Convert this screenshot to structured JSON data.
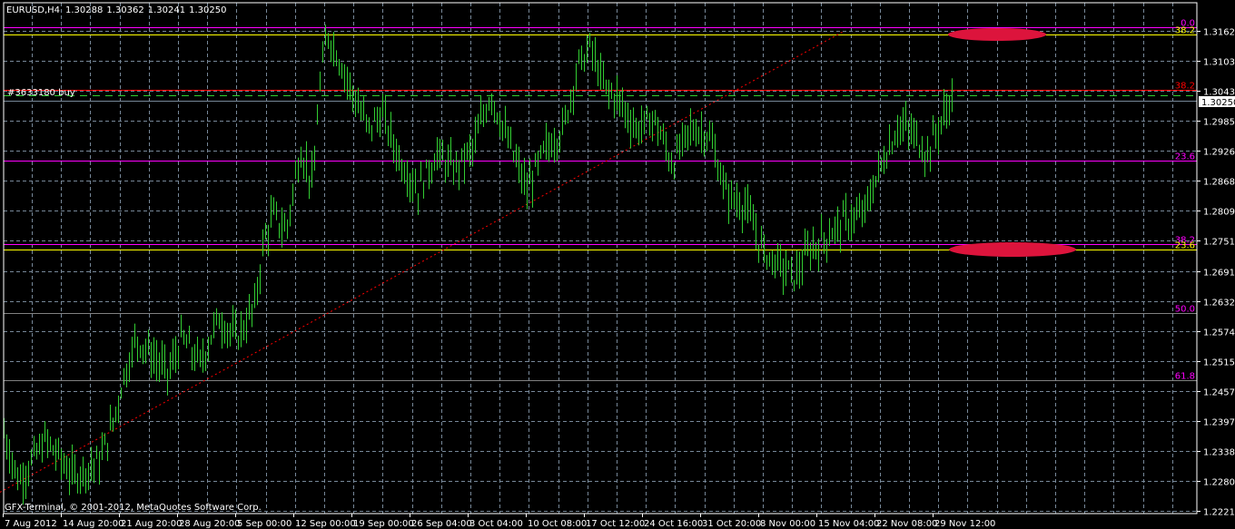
{
  "header": {
    "symbol_tf": "EURUSD,H4",
    "open": "1.30288",
    "high": "1.30362",
    "low": "1.30241",
    "close": "1.30250"
  },
  "order_label": "#3633180 buy",
  "copyright": "GFX-Terminal, © 2001-2012, MetaQuotes Software Corp.",
  "current_price": "1.30250",
  "colors": {
    "background": "#000000",
    "bars": "#32cd32",
    "grid": "#778899",
    "fib_magenta": "#ff00ff",
    "fib_yellow": "#ffff00",
    "fib_red": "#ff0000",
    "ellipse": "#dc143c",
    "trendline": "#ff0000",
    "order_line": "#32cd32"
  },
  "chart_data": {
    "type": "bar",
    "title": "EURUSD,H4",
    "ylim": [
      1.22215,
      1.3162
    ],
    "y_ticks": [
      "1.31620",
      "1.31035",
      "1.30435",
      "1.29850",
      "1.29265",
      "1.28680",
      "1.28095",
      "1.27510",
      "1.26910",
      "1.26325",
      "1.25740",
      "1.25155",
      "1.24570",
      "1.23970",
      "1.23385",
      "1.22800",
      "1.22215"
    ],
    "x_ticks": [
      "7 Aug 2012",
      "14 Aug 20:00",
      "21 Aug 20:00",
      "28 Aug 20:00",
      "5 Sep 00:00",
      "12 Sep 00:00",
      "19 Sep 00:00",
      "26 Sep 04:00",
      "3 Oct 04:00",
      "10 Oct 08:00",
      "17 Oct 12:00",
      "24 Oct 16:00",
      "31 Oct 20:00",
      "8 Nov 00:00",
      "15 Nov 04:00",
      "22 Nov 08:00",
      "29 Nov 12:00"
    ],
    "grid": true,
    "price_path": [
      [
        0,
        1.24
      ],
      [
        20,
        1.228
      ],
      [
        50,
        1.236
      ],
      [
        80,
        1.229
      ],
      [
        110,
        1.232
      ],
      [
        125,
        1.24
      ],
      [
        135,
        1.248
      ],
      [
        150,
        1.256
      ],
      [
        170,
        1.252
      ],
      [
        185,
        1.249
      ],
      [
        200,
        1.256
      ],
      [
        220,
        1.251
      ],
      [
        240,
        1.26
      ],
      [
        260,
        1.256
      ],
      [
        280,
        1.262
      ],
      [
        290,
        1.275
      ],
      [
        300,
        1.28
      ],
      [
        315,
        1.277
      ],
      [
        330,
        1.293
      ],
      [
        345,
        1.286
      ],
      [
        350,
        1.303
      ],
      [
        360,
        1.316
      ],
      [
        375,
        1.31
      ],
      [
        390,
        1.303
      ],
      [
        405,
        1.297
      ],
      [
        420,
        1.3
      ],
      [
        440,
        1.291
      ],
      [
        460,
        1.285
      ],
      [
        480,
        1.292
      ],
      [
        500,
        1.289
      ],
      [
        520,
        1.293
      ],
      [
        540,
        1.304
      ],
      [
        560,
        1.294
      ],
      [
        580,
        1.285
      ],
      [
        600,
        1.293
      ],
      [
        620,
        1.297
      ],
      [
        635,
        1.309
      ],
      [
        650,
        1.313
      ],
      [
        665,
        1.305
      ],
      [
        680,
        1.303
      ],
      [
        700,
        1.297
      ],
      [
        720,
        1.299
      ],
      [
        740,
        1.29
      ],
      [
        760,
        1.297
      ],
      [
        780,
        1.296
      ],
      [
        800,
        1.284
      ],
      [
        820,
        1.282
      ],
      [
        840,
        1.273
      ],
      [
        860,
        1.27
      ],
      [
        875,
        1.268
      ],
      [
        890,
        1.273
      ],
      [
        910,
        1.276
      ],
      [
        930,
        1.279
      ],
      [
        950,
        1.28
      ],
      [
        970,
        1.29
      ],
      [
        990,
        1.298
      ],
      [
        1010,
        1.295
      ],
      [
        1020,
        1.292
      ],
      [
        1035,
        1.298
      ],
      [
        1048,
        1.303
      ]
    ],
    "levels": [
      {
        "label": "0.0",
        "price": 1.3169,
        "color": "#ff00ff",
        "text_color": "#ff00ff"
      },
      {
        "label": "38.2",
        "price": 1.3155,
        "color": "#ffff00",
        "text_color": "#ffff00"
      },
      {
        "label": "38.2",
        "price": 1.3046,
        "color": "#ff0000",
        "text_color": "#ff0000"
      },
      {
        "label": "23.6",
        "price": 1.2907,
        "color": "#ff00ff",
        "text_color": "#ff00ff"
      },
      {
        "label": "38.2",
        "price": 1.2745,
        "color": "#ff00ff",
        "text_color": "#ff00ff"
      },
      {
        "label": "23.6",
        "price": 1.2734,
        "color": "#ffff00",
        "text_color": "#ffff00"
      },
      {
        "label": "50.0",
        "price": 1.2609,
        "color": "#808080",
        "text_color": "#ff00ff"
      },
      {
        "label": "61.8",
        "price": 1.2477,
        "color": "#808080",
        "text_color": "#ff00ff"
      }
    ],
    "order_price": 1.3036,
    "trendline": {
      "from": [
        1.2258,
        0
      ],
      "to": [
        1.3162,
        930
      ]
    }
  }
}
